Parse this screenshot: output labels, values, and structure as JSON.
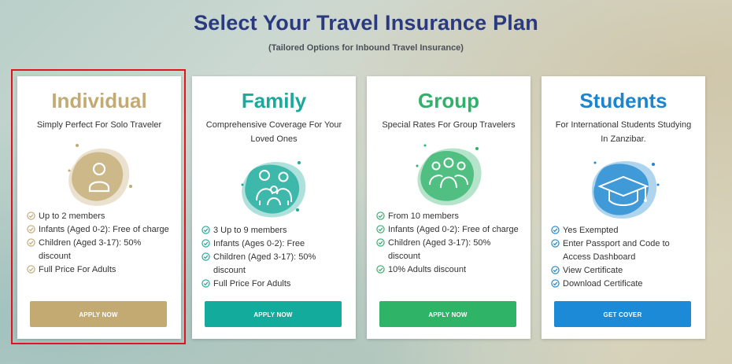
{
  "header": {
    "title": "Select Your Travel Insurance Plan",
    "subtitle": "(Tailored Options for Inbound Travel Insurance)"
  },
  "colors": {
    "heading": "#2b3a7e",
    "selection_outline": "#e0141e"
  },
  "plans": [
    {
      "title": "Individual",
      "tagline": "Simply Perfect For Solo Traveler",
      "icon": "single-person-icon",
      "color": "#c2aa72",
      "button_color": "#c2aa72",
      "button_label": "APPLY NOW",
      "features": [
        "Up to 2 members",
        "Infants (Aged 0-2): Free of charge",
        "Children (Aged 3-17): 50% discount",
        "Full Price For Adults"
      ]
    },
    {
      "title": "Family",
      "tagline": "Comprehensive Coverage For Your Loved Ones",
      "icon": "family-icon",
      "color": "#1aa99c",
      "button_color": "#13ab9b",
      "button_label": "APPLY NOW",
      "features": [
        "3 Up to 9 members",
        "Infants (Ages 0-2): Free",
        "Children (Aged 3-17): 50% discount",
        "Full Price For Adults"
      ]
    },
    {
      "title": "Group",
      "tagline": "Special Rates For Group Travelers",
      "icon": "group-icon",
      "color": "#2fb16a",
      "button_color": "#2fb366",
      "button_label": "APPLY NOW",
      "features": [
        "From 10 members",
        "Infants (Aged 0-2): Free of charge",
        "Children (Aged 3-17): 50% discount",
        "10% Adults discount"
      ]
    },
    {
      "title": "Students",
      "tagline": "For International Students Studying In Zanzibar.",
      "icon": "graduation-cap-icon",
      "color": "#1b86cf",
      "button_color": "#1c8ad6",
      "button_label": "GET COVER",
      "features": [
        "Yes Exempted",
        "Enter Passport and Code to Access Dashboard",
        "View Certificate",
        "Download Certificate"
      ]
    }
  ]
}
